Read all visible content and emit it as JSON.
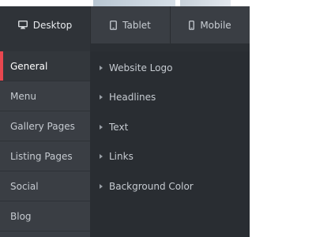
{
  "tabs": [
    {
      "label": "Desktop",
      "icon": "desktop-icon",
      "active": true
    },
    {
      "label": "Tablet",
      "icon": "tablet-icon",
      "active": false
    },
    {
      "label": "Mobile",
      "icon": "mobile-icon",
      "active": false
    }
  ],
  "sidebar": {
    "items": [
      {
        "label": "General",
        "active": true
      },
      {
        "label": "Menu"
      },
      {
        "label": "Gallery Pages"
      },
      {
        "label": "Listing Pages"
      },
      {
        "label": "Social"
      },
      {
        "label": "Blog"
      }
    ]
  },
  "content": {
    "items": [
      {
        "label": "Website Logo",
        "icon": "caret-right-icon"
      },
      {
        "label": "Headlines",
        "icon": "caret-right-icon"
      },
      {
        "label": "Text",
        "icon": "caret-right-icon"
      },
      {
        "label": "Links",
        "icon": "caret-right-icon"
      },
      {
        "label": "Background Color",
        "icon": "caret-right-icon"
      }
    ]
  },
  "colors": {
    "accent": "#e8474f",
    "panel_bg": "#292d32",
    "sidebar_bg": "#3a3e44"
  }
}
